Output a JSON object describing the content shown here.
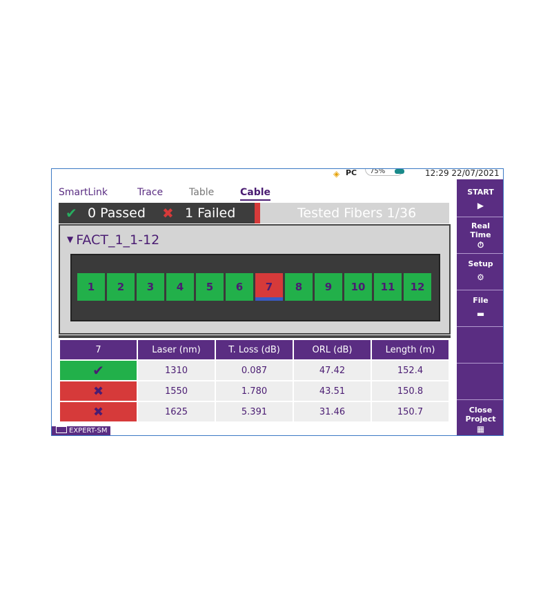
{
  "status": {
    "battery": "75%",
    "time": "12:29",
    "date": "22/07/2021",
    "plug_icon": "pc-plug-icon"
  },
  "tabs": [
    {
      "label": "SmartLink",
      "active": false
    },
    {
      "label": "Trace",
      "active": false
    },
    {
      "label": "Table",
      "active": false
    },
    {
      "label": "Cable",
      "active": true
    }
  ],
  "summary": {
    "passed": "0 Passed",
    "failed": "1 Failed",
    "tested": "Tested Fibers 1/36"
  },
  "cable": {
    "name": "FACT_1_1-12",
    "fibers": [
      {
        "label": "1",
        "status": "pass"
      },
      {
        "label": "2",
        "status": "pass"
      },
      {
        "label": "3",
        "status": "pass"
      },
      {
        "label": "4",
        "status": "pass"
      },
      {
        "label": "5",
        "status": "pass"
      },
      {
        "label": "6",
        "status": "pass"
      },
      {
        "label": "7",
        "status": "fail"
      },
      {
        "label": "8",
        "status": "pass"
      },
      {
        "label": "9",
        "status": "pass"
      },
      {
        "label": "10",
        "status": "pass"
      },
      {
        "label": "11",
        "status": "pass"
      },
      {
        "label": "12",
        "status": "pass"
      }
    ]
  },
  "results": {
    "headers": [
      "7",
      "Laser (nm)",
      "T. Loss (dB)",
      "ORL (dB)",
      "Length (m)"
    ],
    "rows": [
      {
        "status": "pass",
        "laser": "1310",
        "loss": "0.087",
        "orl": "47.42",
        "length": "152.4"
      },
      {
        "status": "fail",
        "laser": "1550",
        "loss": "1.780",
        "orl": "43.51",
        "length": "150.8"
      },
      {
        "status": "fail",
        "laser": "1625",
        "loss": "5.391",
        "orl": "31.46",
        "length": "150.7"
      }
    ]
  },
  "mode": "EXPERT-SM",
  "sidebar": {
    "start": {
      "label": "START",
      "icon": "play-icon"
    },
    "realtime": {
      "label": "Real Time",
      "icon": "stopwatch-icon"
    },
    "setup": {
      "label": "Setup",
      "icon": "gear-icon"
    },
    "file": {
      "label": "File",
      "icon": "folder-icon"
    },
    "close": {
      "label": "Close Project",
      "icon": "grid-icon"
    }
  },
  "colors": {
    "accent": "#5a2d82",
    "pass": "#22b04a",
    "fail": "#d63a3a"
  }
}
